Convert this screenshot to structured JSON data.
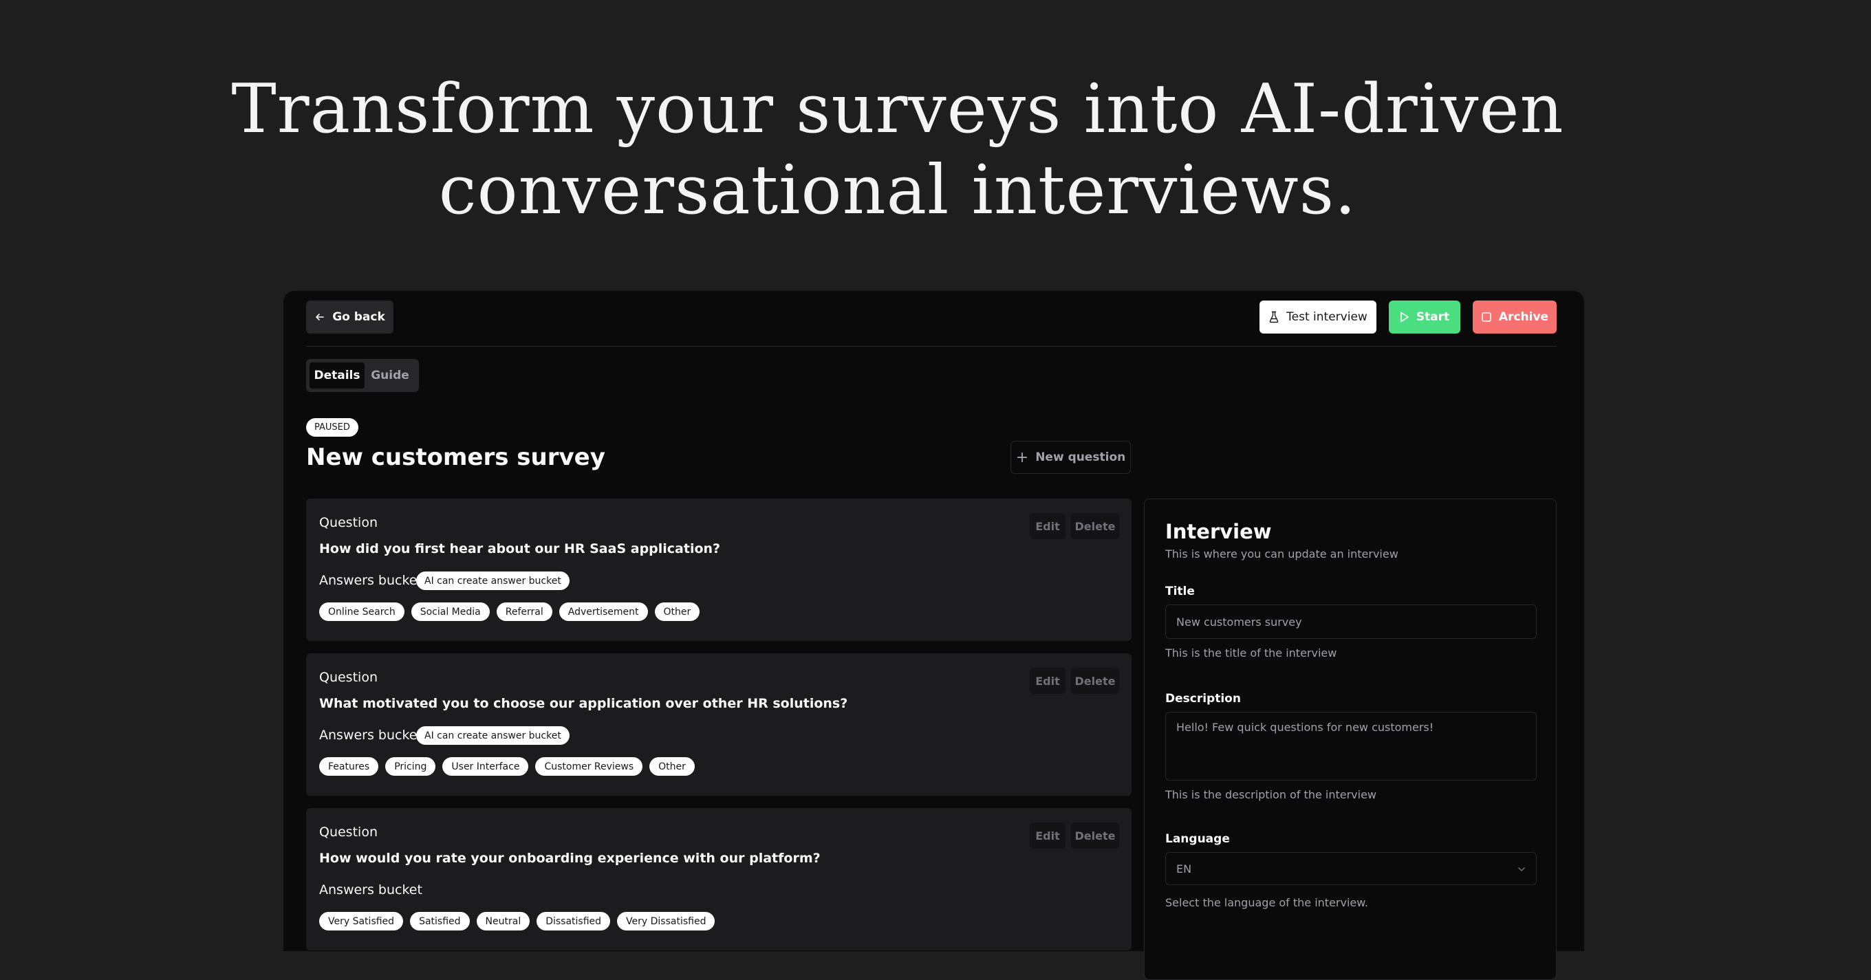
{
  "hero": {
    "line1": "Transform your surveys into AI-driven",
    "line2": "conversational interviews."
  },
  "toolbar": {
    "go_back": "Go back",
    "test_interview": "Test interview",
    "start": "Start",
    "archive": "Archive"
  },
  "tabs": [
    {
      "label": "Details",
      "active": true
    },
    {
      "label": "Guide",
      "active": false
    }
  ],
  "survey": {
    "status": "PAUSED",
    "title": "New customers survey",
    "new_question": "New question"
  },
  "questions": [
    {
      "label": "Question",
      "text": "How did you first hear about our HR SaaS application?",
      "edit": "Edit",
      "delete": "Delete",
      "answers_label": "Answers bucket",
      "ai_badge": "AI can create answer bucket",
      "answers": [
        "Online Search",
        "Social Media",
        "Referral",
        "Advertisement",
        "Other"
      ]
    },
    {
      "label": "Question",
      "text": "What motivated you to choose our application over other HR solutions?",
      "edit": "Edit",
      "delete": "Delete",
      "answers_label": "Answers bucket",
      "ai_badge": "AI can create answer bucket",
      "answers": [
        "Features",
        "Pricing",
        "User Interface",
        "Customer Reviews",
        "Other"
      ]
    },
    {
      "label": "Question",
      "text": "How would you rate your onboarding experience with our platform?",
      "edit": "Edit",
      "delete": "Delete",
      "answers_label": "Answers bucket",
      "ai_badge": "",
      "answers": [
        "Very Satisfied",
        "Satisfied",
        "Neutral",
        "Dissatisfied",
        "Very Dissatisfied"
      ]
    }
  ],
  "interview_panel": {
    "title": "Interview",
    "subtitle": "This is where you can update an interview",
    "title_label": "Title",
    "title_value": "New customers survey",
    "title_help": "This is the title of the interview",
    "description_label": "Description",
    "description_value": "Hello! Few quick questions for new customers!",
    "description_help": "This is the description of the interview",
    "language_label": "Language",
    "language_value": "EN",
    "language_help": "Select the language of the interview."
  },
  "colors": {
    "page_bg": "#1e1e1e",
    "app_bg": "#0a0a0b",
    "start": "#4ade80",
    "archive": "#f87171"
  }
}
